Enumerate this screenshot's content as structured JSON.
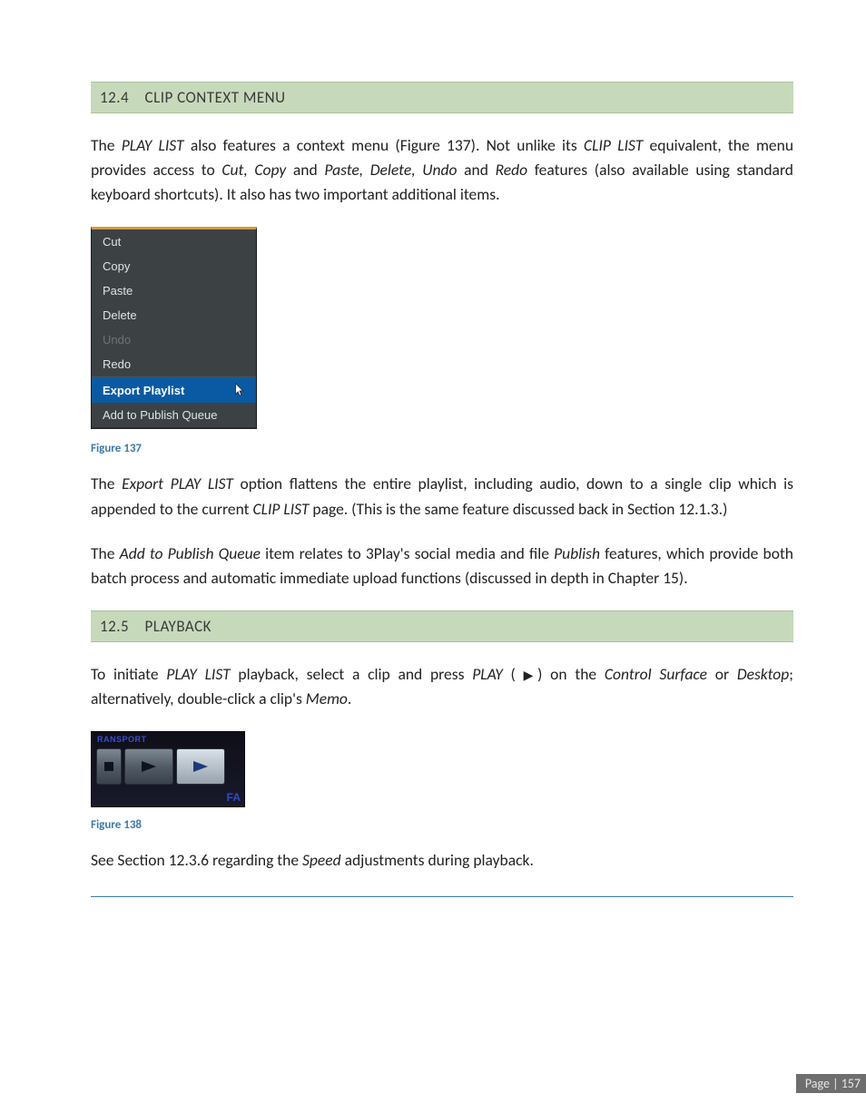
{
  "section1": {
    "number": "12.4",
    "title": "CLIP CONTEXT MENU",
    "paragraph1_pre": "The ",
    "playlist_em": "PLAY LIST",
    "paragraph1_mid1": " also features a context menu (Figure 137).  Not unlike its ",
    "cliplist_em": "CLIP LIST",
    "paragraph1_mid2": " equivalent, the menu provides access to ",
    "cutcopy_em": "Cut, Copy",
    "paragraph1_mid3": " and ",
    "pastedelete_em": "Paste, Delete, Undo",
    "paragraph1_mid4": " and ",
    "redo_em": "Redo",
    "paragraph1_end": " features (also available using standard keyboard shortcuts).  It also has two important additional items."
  },
  "context_menu": {
    "items": [
      {
        "label": "Cut",
        "disabled": false
      },
      {
        "label": "Copy",
        "disabled": false
      },
      {
        "label": "Paste",
        "disabled": false
      },
      {
        "label": "Delete",
        "disabled": false
      },
      {
        "label": "Undo",
        "disabled": true
      },
      {
        "label": "Redo",
        "disabled": false
      }
    ],
    "highlight_label": "Export Playlist",
    "last_label": "Add to Publish Queue"
  },
  "figure137": "Figure 137",
  "para2": {
    "pre": "The ",
    "export_em": "Export PLAY LIST",
    "mid1": " option flattens the entire playlist, including audio, down to a single clip which is appended to the current ",
    "cliplist_em": "CLIP LIST",
    "end": " page. (This is the same feature discussed back in Section 12.1.3.)"
  },
  "para3": {
    "pre": "The ",
    "addpub_em": "Add to Publish Queue",
    "mid": " item relates to 3Play's social media and file ",
    "publish_em": "Publish",
    "end": " features, which provide both batch process and automatic immediate upload functions (discussed in depth in Chapter 15)."
  },
  "section2": {
    "number": "12.5",
    "title": "PLAYBACK",
    "para_pre": "To initiate ",
    "playlist_em": "PLAY LIST",
    "para_mid1": " playback, select a clip and press ",
    "play_em": "PLAY",
    "para_mid2": " ( ",
    "play_glyph": "▶",
    "para_mid3": ") on the ",
    "controlsurface_em": "Control Surface",
    "para_mid4": " or ",
    "desktop_em": "Desktop",
    "para_mid5": "; alternatively, double-click a clip's ",
    "memo_em": "Memo",
    "para_end": "."
  },
  "transport": {
    "label": "RANSPORT",
    "fa": "FA"
  },
  "figure138": "Figure 138",
  "para4": {
    "pre": "See Section 12.3.6 regarding the ",
    "speed_em": "Speed",
    "end": " adjustments during playback."
  },
  "page_number": "Page | 157"
}
